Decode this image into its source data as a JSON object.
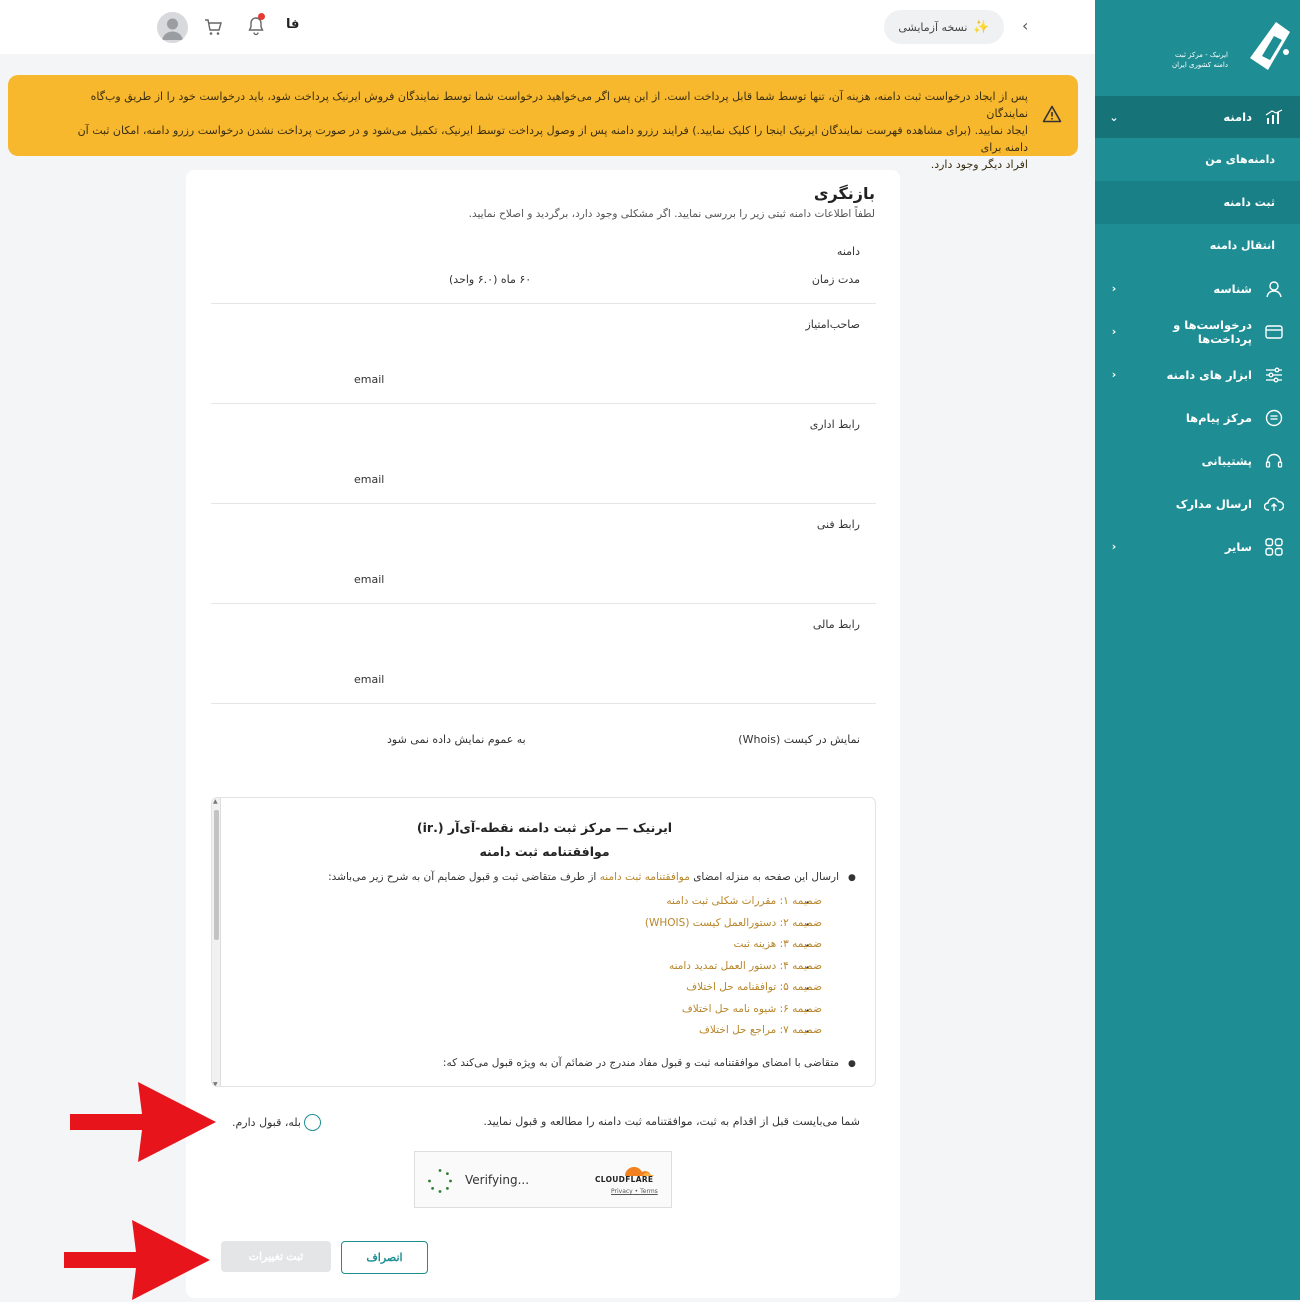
{
  "topbar": {
    "demo_label": "نسخه آزمایشی",
    "lang": "فا"
  },
  "warning": {
    "line1": "پس از ایجاد درخواست ثبت دامنه، هزینه آن، تنها توسط شما قابل پرداخت است. از این پس اگر می‌خواهید درخواست شما توسط نمایندگان فروش ایرنیک پرداخت شود، باید درخواست خود را از طریق وب‌گاه نمایندگان",
    "line2": "ایجاد نمایید. (برای مشاهده فهرست نمایندگان ایرنیک اینجا را کلیک نمایید.) فرایند رزرو دامنه پس از وصول پرداخت توسط ایرنیک، تکمیل می‌شود و در صورت پرداخت نشدن درخواست رزرو دامنه، امکان ثبت آن دامنه برای",
    "line3": "افراد دیگر وجود دارد."
  },
  "sidebar": {
    "logo_line1": "ایرنیک - مرکز ثبت",
    "logo_line2": "دامنه کشوری ایران",
    "domain": "دامنه",
    "sub": [
      "دامنه‌های من",
      "ثبت دامنه",
      "انتقال دامنه"
    ],
    "items": [
      "شناسه",
      "درخواست‌ها و پرداخت‌ها",
      "ابزار های دامنه",
      "مرکز پیام‌ها",
      "پشتیبانی",
      "ارسال مدارک",
      "سایر"
    ]
  },
  "review": {
    "title": "بازنگری",
    "subtitle": "لطفاً اطلاعات دامنه ثبتی زیر را بررسی نمایید. اگر مشکلی وجود دارد، برگردید و اصلاح نمایید.",
    "domain_label": "دامنه",
    "duration_label": "مدت زمان",
    "duration_value": "۶۰ ماه (۶.۰ واحد)",
    "holder_label": "صاحب‌امتیاز",
    "admin_label": "رابط اداری",
    "tech_label": "رابط فنی",
    "billing_label": "رابط مالی",
    "email": "email",
    "whois_label": "نمایش در کیست (Whois)",
    "whois_value": "به عموم نمایش داده نمی شود"
  },
  "agreement": {
    "title1": "ایرنیک — مرکز ثبت دامنه نقطه-آی‌آر (.ir)",
    "title2": "موافقتنامه ثبت دامنه",
    "intro_a": "ارسال این صفحه به منزله امضای ",
    "intro_link": "موافقتنامه ثبت دامنه",
    "intro_b": " از طرف متقاضی ثبت و قبول ضمایم آن به شرح زیر می‌باشد:",
    "annexes": [
      "ضمیمه ۱: مقررات شکلی ثبت دامنه",
      "ضمیمه ۲: دستورالعمل کیست (WHOIS)",
      "ضمیمه ۳: هزینه ثبت",
      "ضمیمه ۴: دستور العمل تمدید دامنه",
      "ضمیمه ۵: توافقنامه حل اختلاف",
      "ضمیمه ۶: شیوه نامه حل اختلاف",
      "ضمیمه ۷: مراجع حل اختلاف"
    ],
    "outro": "متقاضی با امضای موافقتنامه ثبت و قبول مفاد مندرج در ضمائم آن به ویژه قبول می‌کند که:"
  },
  "consent": {
    "must_read": "شما می‌بایست قبل از اقدام به ثبت، موافقتنامه ثبت دامنه را مطالعه و قبول نمایید.",
    "accept": "بله، قبول دارم."
  },
  "captcha": {
    "status": "Verifying...",
    "brand": "CLOUDFLARE",
    "privacy": "Privacy",
    "sep": "•",
    "terms": "Terms"
  },
  "buttons": {
    "submit": "ثبت تغییرات",
    "cancel": "انصراف"
  },
  "colors": {
    "sidebar": "#1e8e94",
    "warning": "#f8b82d",
    "link": "#b8862b",
    "arrow": "#e8141b"
  }
}
